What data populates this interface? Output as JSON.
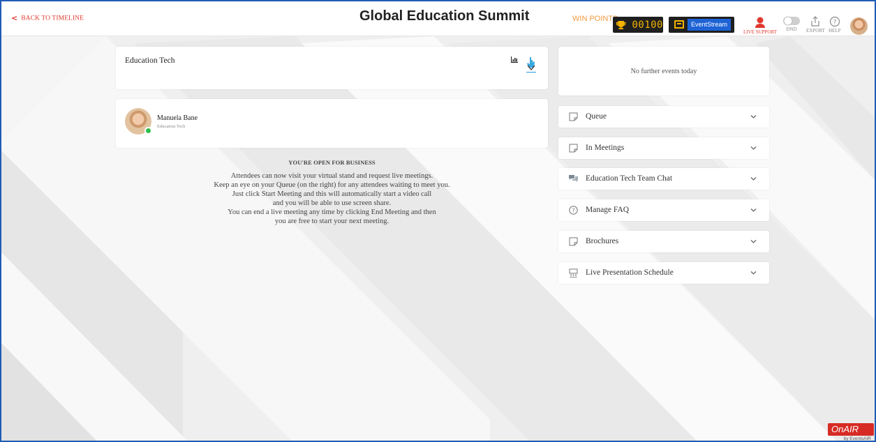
{
  "header": {
    "back_label": "BACK TO TIMELINE",
    "title": "Global Education Summit",
    "win_points_label": "WIN POINTS",
    "points_value": "00100",
    "eventstream_label": "EventStream",
    "live_support_label": "LIVE SUPPORT",
    "dnd_label": "DND",
    "export_label": "EXPORT",
    "help_label": "HELP"
  },
  "stand": {
    "title": "Education Tech"
  },
  "user": {
    "name": "Manuela Bane",
    "role": "Education Tech",
    "status": "online"
  },
  "open_message": {
    "heading": "YOU'RE OPEN FOR BUSINESS",
    "lines": [
      "Attendees can now visit your virtual stand and request live meetings.",
      "Keep an eye on your Queue (on the right) for any attendees waiting to meet you.",
      "Just click Start Meeting and this will automatically start a video call",
      "and you will be able to use screen share.",
      "You can end a live meeting any time by clicking End Meeting and then",
      "you are free to start your next meeting."
    ]
  },
  "events": {
    "text": "No further events today"
  },
  "panels": [
    {
      "label": "Queue",
      "icon": "note-icon"
    },
    {
      "label": "In Meetings",
      "icon": "note-icon"
    },
    {
      "label": "Education Tech Team Chat",
      "icon": "chat-icon"
    },
    {
      "label": "Manage FAQ",
      "icon": "question-icon"
    },
    {
      "label": "Brochures",
      "icon": "note-icon"
    },
    {
      "label": "Live Presentation Schedule",
      "icon": "presentation-icon"
    }
  ],
  "branding": {
    "onair": "OnAIR",
    "by": "by EventsAIR"
  },
  "colors": {
    "accent_red": "#e03a2e",
    "points_gold": "#f5b400",
    "eventstream_blue": "#1e63d6",
    "online_green": "#2dbd4a",
    "frame_blue": "#1f5bb5"
  }
}
